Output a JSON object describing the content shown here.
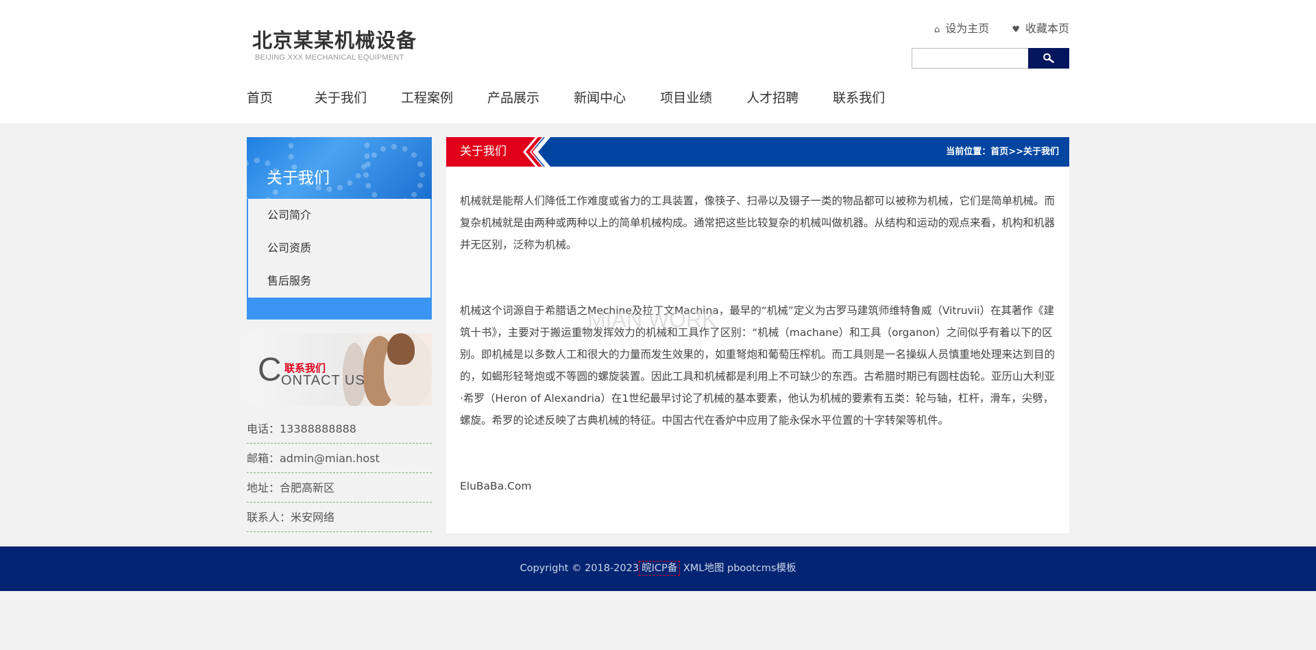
{
  "header": {
    "logo_cn": "北京某某机械设备",
    "logo_en": "BEIJING XXX MECHANICAL EQUIPMENT",
    "set_home": "设为主页",
    "favorite": "收藏本页",
    "search_placeholder": ""
  },
  "nav": [
    "首页",
    "关于我们",
    "工程案例",
    "产品展示",
    "新闻中心",
    "项目业绩",
    "人才招聘",
    "联系我们"
  ],
  "sidebar": {
    "title": "关于我们",
    "items": [
      "公司简介",
      "公司资质",
      "售后服务"
    ],
    "contact_cn": "联系我们",
    "contact_c": "C",
    "contact_en": "ONTACT US",
    "contacts": [
      "电话：13388888888",
      "邮箱：admin@mian.host",
      "地址：合肥高新区",
      "联系人：米安网络"
    ]
  },
  "content": {
    "tab": "关于我们",
    "breadcrumb": "当前位置：首页>>关于我们",
    "watermark": "MIAN WORK",
    "paragraphs": [
      "机械就是能帮人们降低工作难度或省力的工具装置，像筷子、扫帚以及镊子一类的物品都可以被称为机械，它们是简单机械。而复杂机械就是由两种或两种以上的简单机械构成。通常把这些比较复杂的机械叫做机器。从结构和运动的观点来看，机构和机器并无区别，泛称为机械。",
      "机械这个词源自于希腊语之Mechine及拉丁文Machina，最早的“机械”定义为古罗马建筑师维特鲁威（Vitruvii）在其著作《建筑十书》，主要对于搬运重物发挥效力的机械和工具作了区别：“机械（machane）和工具（organon）之间似乎有着以下的区别。即机械是以多数人工和很大的力量而发生效果的，如重弩炮和葡萄压榨机。而工具则是一名操纵人员慎重地处理来达到目的的，如蝎形轻弩炮或不等圆的螺旋装置。因此工具和机械都是利用上不可缺少的东西。古希腊时期已有圆柱齿轮。亚历山大利亚·希罗（Heron of Alexandria）在1世纪最早讨论了机械的基本要素，他认为机械的要素有五类：轮与轴，杠杆，滑车，尖劈，螺旋。希罗的论述反映了古典机械的特征。中国古代在香炉中应用了能永保水平位置的十字转架等机件。",
      "EluBaBa.Com"
    ]
  },
  "footer": {
    "copyright": "Copyright © 2018-2023",
    "icp": "皖ICP备",
    "xml": "XML地图",
    "template": "pbootcms模板"
  },
  "colors": {
    "nav_blue": "#0145a0",
    "accent_red": "#e0001a",
    "side_blue": "#3a95f2",
    "footer_blue": "#022472"
  }
}
